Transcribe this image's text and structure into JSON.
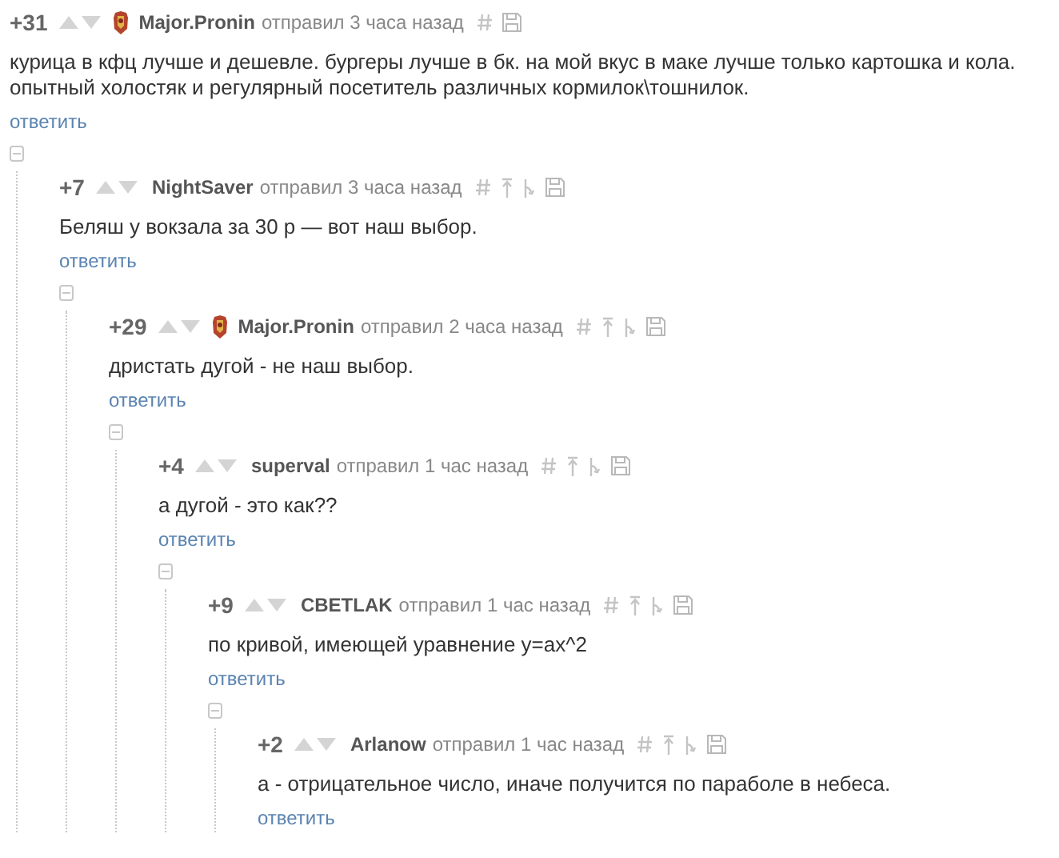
{
  "comments": [
    {
      "rating": "+31",
      "avatar": true,
      "author": "Major.Pronin",
      "meta": "отправил 3 часа назад",
      "parent_links": false,
      "body": "курица в кфц лучше и дешевле. бургеры лучше в бк. на мой вкус в маке лучше только картошка и кола. опытный холостяк и регулярный посетитель различных кормилок\\тошнилок.",
      "reply": "ответить",
      "expanded": true,
      "children": [
        {
          "rating": "+7",
          "avatar": false,
          "author": "NightSaver",
          "meta": "отправил 3 часа назад",
          "parent_links": true,
          "body": "Беляш у вокзала за 30 р — вот наш выбор.",
          "reply": "ответить",
          "expanded": true,
          "children": [
            {
              "rating": "+29",
              "avatar": true,
              "author": "Major.Pronin",
              "meta": "отправил 2 часа назад",
              "parent_links": true,
              "body": "дристать дугой - не наш выбор.",
              "reply": "ответить",
              "expanded": true,
              "children": [
                {
                  "rating": "+4",
                  "avatar": false,
                  "author": "superval",
                  "meta": "отправил 1 час назад",
                  "parent_links": true,
                  "body": "а дугой - это как??",
                  "reply": "ответить",
                  "expanded": true,
                  "children": [
                    {
                      "rating": "+9",
                      "avatar": false,
                      "author": "CBETLAK",
                      "meta": "отправил 1 час назад",
                      "parent_links": true,
                      "body": "по кривой, имеющей уравнение y=ax^2",
                      "reply": "ответить",
                      "expanded": true,
                      "children": [
                        {
                          "rating": "+2",
                          "avatar": false,
                          "author": "Arlanow",
                          "meta": "отправил 1 час назад",
                          "parent_links": true,
                          "body": "а - отрицательное число, иначе получится по параболе в небеса.",
                          "reply": "ответить"
                        }
                      ]
                    }
                  ]
                }
              ]
            }
          ]
        }
      ]
    }
  ]
}
